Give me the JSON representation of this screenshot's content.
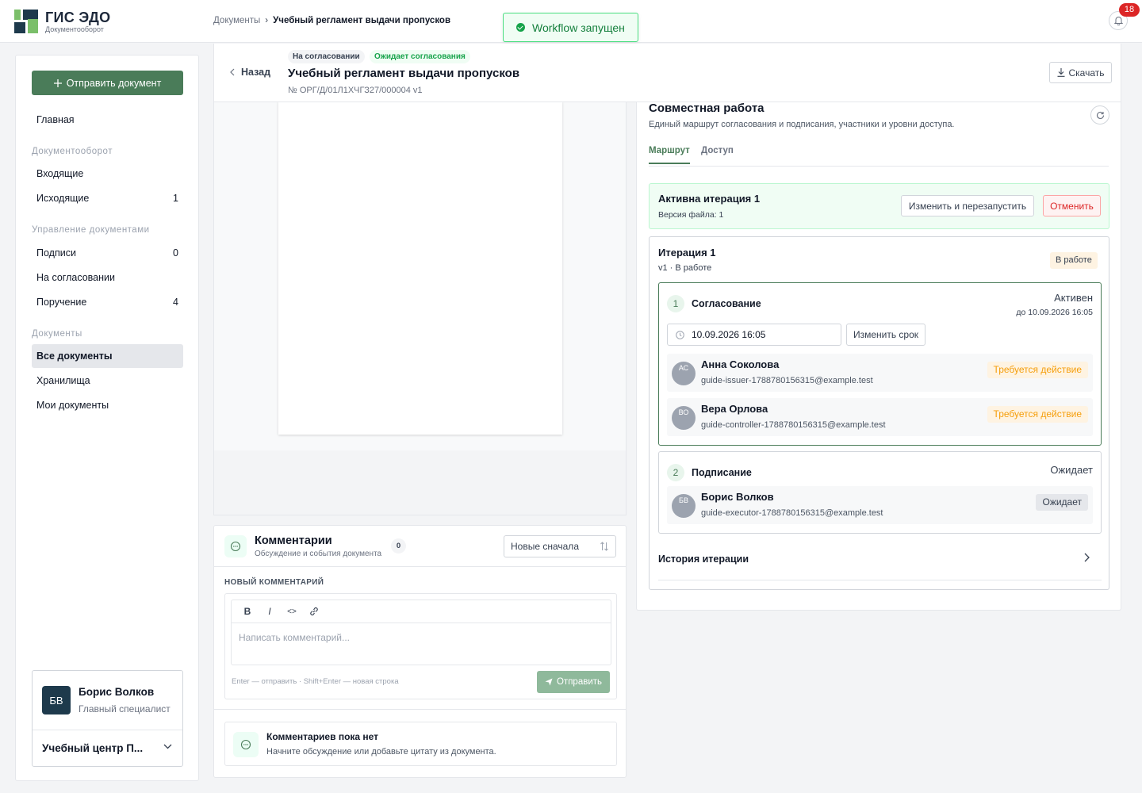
{
  "app": {
    "brand_name": "ГИС ЭДО",
    "brand_sub": "Документооборот",
    "notification_count": "18"
  },
  "breadcrumb": {
    "parent": "Документы",
    "separator": "›",
    "current": "Учебный регламент выдачи пропусков"
  },
  "toast": {
    "text": "Workflow запущен"
  },
  "sidebar": {
    "send_label": "Отправить документ",
    "home": "Главная",
    "groups": {
      "workflow": "Документооборот",
      "management": "Управление документами",
      "documents": "Документы"
    },
    "items": [
      {
        "label": "Входящие",
        "count": ""
      },
      {
        "label": "Исходящие",
        "count": "1"
      },
      {
        "label": "Подписи",
        "count": "0"
      },
      {
        "label": "На согласовании",
        "count": ""
      },
      {
        "label": "Поручение",
        "count": "4"
      },
      {
        "label": "Все документы",
        "count": ""
      },
      {
        "label": "Хранилища",
        "count": ""
      },
      {
        "label": "Мои документы",
        "count": ""
      }
    ],
    "user": {
      "initials": "БВ",
      "name": "Борис Волков",
      "role": "Главный специалист",
      "org": "Учебный центр П..."
    }
  },
  "document": {
    "back_label": "Назад",
    "badge_status": "На согласовании",
    "badge_waiting": "Ожидает согласования",
    "title": "Учебный регламент выдачи пропусков",
    "number": "№ ОРГ/Д/01Л1ХЧГЗ27/000004  v1",
    "download_label": "Скачать"
  },
  "comments": {
    "title": "Комментарии",
    "subtitle": "Обсуждение и события документа",
    "count": "0",
    "sort_label": "Новые сначала",
    "new_label": "НОВЫЙ КОММЕНТАРИЙ",
    "toolbar": {
      "bold": "B",
      "italic": "I",
      "code": "<>"
    },
    "placeholder": "Написать комментарий...",
    "hint": "Enter — отправить · Shift+Enter — новая строка",
    "send_label": "Отправить",
    "empty_title": "Комментариев пока нет",
    "empty_sub": "Начните обсуждение или добавьте цитату из документа."
  },
  "collab": {
    "title": "Совместная работа",
    "subtitle": "Единый маршрут согласования и подписания, участники и уровни доступа.",
    "tabs": [
      {
        "label": "Маршрут"
      },
      {
        "label": "Доступ"
      }
    ],
    "active_iteration": {
      "title": "Активна итерация 1",
      "sub": "Версия файла: 1",
      "restart_label": "Изменить и перезапустить",
      "cancel_label": "Отменить"
    },
    "iteration": {
      "title": "Итерация 1",
      "sub": "v1 · В работе",
      "status": "В работе",
      "stages": [
        {
          "num": "1",
          "name": "Согласование",
          "state": "Активен",
          "due": "до 10.09.2026 16:05",
          "date_value": "10.09.2026 16:05",
          "change_due_label": "Изменить срок",
          "participants": [
            {
              "initials": "АС",
              "name": "Анна Соколова",
              "email": "guide-issuer-1788780156315@example.test",
              "status": "Требуется действие"
            },
            {
              "initials": "ВО",
              "name": "Вера Орлова",
              "email": "guide-controller-1788780156315@example.test",
              "status": "Требуется действие"
            }
          ]
        },
        {
          "num": "2",
          "name": "Подписание",
          "state": "Ожидает",
          "participants": [
            {
              "initials": "БВ",
              "name": "Борис Волков",
              "email": "guide-executor-1788780156315@example.test",
              "status": "Ожидает"
            }
          ]
        }
      ],
      "history_label": "История итерации"
    }
  },
  "colors": {
    "accent": "#4a7c59",
    "danger": "#dc2626",
    "warning": "#f59e0b"
  },
  "icons": [
    "bell-icon",
    "plus-icon",
    "chevron-left-icon",
    "download-icon",
    "check-circle-icon",
    "comment-icon",
    "sort-icon",
    "link-icon",
    "send-icon",
    "refresh-icon",
    "clock-icon",
    "chevron-right-icon",
    "chevron-down-icon"
  ]
}
